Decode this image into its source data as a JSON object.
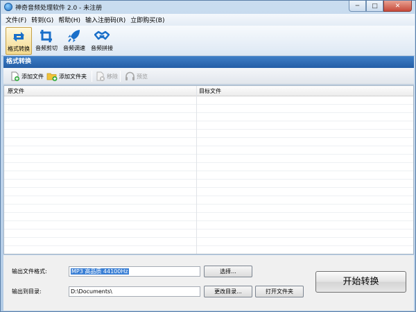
{
  "window": {
    "title": "神奇音频处理软件 2.0 - 未注册",
    "controls": {
      "minimize": "─",
      "maximize": "□",
      "close": "✕"
    }
  },
  "menu": [
    "文件(F)",
    "转到(G)",
    "帮助(H)",
    "输入注册码(R)",
    "立即购买(B)"
  ],
  "toolbar": {
    "items": [
      {
        "label": "格式转换",
        "icon": "convert-icon",
        "active": true
      },
      {
        "label": "音频剪切",
        "icon": "crop-icon",
        "active": false
      },
      {
        "label": "音频调速",
        "icon": "rocket-icon",
        "active": false
      },
      {
        "label": "音频拼接",
        "icon": "handshake-icon",
        "active": false
      }
    ]
  },
  "section": {
    "title": "格式转换"
  },
  "subtoolbar": {
    "add_file": "添加文件",
    "add_folder": "添加文件夹",
    "remove": "移除",
    "preview": "预览"
  },
  "filelist": {
    "columns": [
      "原文件",
      "目标文件"
    ],
    "rows": []
  },
  "output": {
    "format_label": "输出文件格式:",
    "format_value": "MP3 高品质 44100Hz",
    "select_button": "选择...",
    "dir_label": "输出到目录:",
    "dir_value": "D:\\Documents\\",
    "change_dir_button": "更改目录...",
    "open_folder_button": "打开文件夹",
    "start_button": "开始转换"
  },
  "colors": {
    "section_header": "#245ea6",
    "accent": "#1e6fc4",
    "active_tool": "#f3d98f"
  }
}
